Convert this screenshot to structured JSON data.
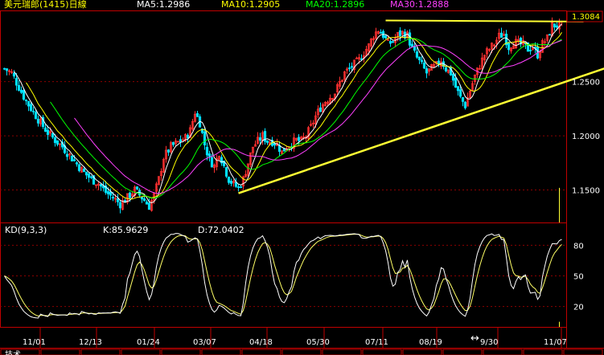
{
  "header": {
    "title": "美元瑞郎(1415)日線",
    "ma5": "MA5:1.2986",
    "ma10": "MA10:1.2905",
    "ma20": "MA20:1.2896",
    "ma30": "MA30:1.2888"
  },
  "indicator": {
    "name": "KD(9,3,3)",
    "k": "K:85.9629",
    "d": "D:72.0402"
  },
  "price_badge": "1.3084",
  "colors": {
    "up": "#ff3030",
    "down": "#00e0ff",
    "ma5": "#ffffff",
    "ma10": "#ffff00",
    "ma20": "#00ff00",
    "ma30": "#ff40ff",
    "trend": "#ffff33",
    "grid": "#8b0000",
    "axis": "#c00000",
    "k": "#ffffff",
    "d": "#ffff66"
  },
  "bottom_tabs": [
    "技术",
    "",
    "",
    "",
    "",
    "",
    "",
    "",
    "",
    "",
    "",
    "",
    "",
    "",
    ""
  ],
  "chart_data": [
    {
      "type": "candlestick",
      "title": "美元瑞郎(1415)日線",
      "x_ticks": [
        "11/01",
        "12/13",
        "01/24",
        "03/07",
        "04/18",
        "05/30",
        "07/11",
        "08/19",
        "9/30",
        "11/07"
      ],
      "y_ticks": [
        "1.2500",
        "1.2000",
        "1.1500"
      ],
      "ylim": [
        1.12,
        1.315
      ],
      "last_price": 1.3084,
      "series": [
        {
          "name": "MA5",
          "last": 1.2986
        },
        {
          "name": "MA10",
          "last": 1.2905
        },
        {
          "name": "MA20",
          "last": 1.2896
        },
        {
          "name": "MA30",
          "last": 1.2888
        }
      ],
      "close_path": [
        [
          0,
          1.262
        ],
        [
          3,
          1.258
        ],
        [
          6,
          1.245
        ],
        [
          9,
          1.232
        ],
        [
          12,
          1.222
        ],
        [
          15,
          1.212
        ],
        [
          18,
          1.203
        ],
        [
          21,
          1.196
        ],
        [
          24,
          1.19
        ],
        [
          27,
          1.182
        ],
        [
          30,
          1.174
        ],
        [
          33,
          1.166
        ],
        [
          36,
          1.16
        ],
        [
          39,
          1.156
        ],
        [
          42,
          1.148
        ],
        [
          45,
          1.143
        ],
        [
          48,
          1.137
        ],
        [
          51,
          1.143
        ],
        [
          54,
          1.15
        ],
        [
          57,
          1.143
        ],
        [
          60,
          1.135
        ],
        [
          62,
          1.145
        ],
        [
          64,
          1.16
        ],
        [
          66,
          1.18
        ],
        [
          69,
          1.19
        ],
        [
          72,
          1.194
        ],
        [
          75,
          1.198
        ],
        [
          77,
          1.205
        ],
        [
          79,
          1.222
        ],
        [
          81,
          1.212
        ],
        [
          83,
          1.192
        ],
        [
          85,
          1.178
        ],
        [
          87,
          1.172
        ],
        [
          89,
          1.185
        ],
        [
          91,
          1.172
        ],
        [
          93,
          1.16
        ],
        [
          95,
          1.155
        ],
        [
          97,
          1.152
        ],
        [
          99,
          1.16
        ],
        [
          101,
          1.175
        ],
        [
          103,
          1.19
        ],
        [
          105,
          1.195
        ],
        [
          107,
          1.2
        ],
        [
          109,
          1.195
        ],
        [
          111,
          1.195
        ],
        [
          113,
          1.192
        ],
        [
          115,
          1.185
        ],
        [
          117,
          1.19
        ],
        [
          119,
          1.193
        ],
        [
          121,
          1.196
        ],
        [
          123,
          1.195
        ],
        [
          125,
          1.2
        ],
        [
          127,
          1.208
        ],
        [
          129,
          1.218
        ],
        [
          131,
          1.226
        ],
        [
          133,
          1.232
        ],
        [
          135,
          1.236
        ],
        [
          137,
          1.24
        ],
        [
          139,
          1.249
        ],
        [
          141,
          1.258
        ],
        [
          143,
          1.262
        ],
        [
          145,
          1.266
        ],
        [
          147,
          1.27
        ],
        [
          149,
          1.277
        ],
        [
          151,
          1.283
        ],
        [
          153,
          1.293
        ],
        [
          155,
          1.298
        ],
        [
          157,
          1.293
        ],
        [
          159,
          1.285
        ],
        [
          161,
          1.287
        ],
        [
          163,
          1.293
        ],
        [
          165,
          1.295
        ],
        [
          167,
          1.293
        ],
        [
          169,
          1.28
        ],
        [
          171,
          1.272
        ],
        [
          173,
          1.265
        ],
        [
          175,
          1.258
        ],
        [
          177,
          1.262
        ],
        [
          179,
          1.265
        ],
        [
          181,
          1.27
        ],
        [
          183,
          1.262
        ],
        [
          185,
          1.258
        ],
        [
          187,
          1.245
        ],
        [
          189,
          1.235
        ],
        [
          191,
          1.228
        ],
        [
          193,
          1.242
        ],
        [
          195,
          1.255
        ],
        [
          197,
          1.265
        ],
        [
          199,
          1.275
        ],
        [
          201,
          1.28
        ],
        [
          203,
          1.285
        ],
        [
          205,
          1.292
        ],
        [
          207,
          1.294
        ],
        [
          209,
          1.282
        ],
        [
          211,
          1.287
        ],
        [
          213,
          1.285
        ],
        [
          215,
          1.284
        ],
        [
          217,
          1.28
        ],
        [
          219,
          1.282
        ],
        [
          221,
          1.275
        ],
        [
          223,
          1.285
        ],
        [
          225,
          1.29
        ],
        [
          227,
          1.302
        ]
      ]
    },
    {
      "type": "line",
      "title": "KD(9,3,3)",
      "y_ticks": [
        "80",
        "50",
        "20"
      ],
      "ylim": [
        0,
        100
      ],
      "series": [
        {
          "name": "K",
          "last": 85.9629
        },
        {
          "name": "D",
          "last": 72.0402
        }
      ]
    }
  ]
}
